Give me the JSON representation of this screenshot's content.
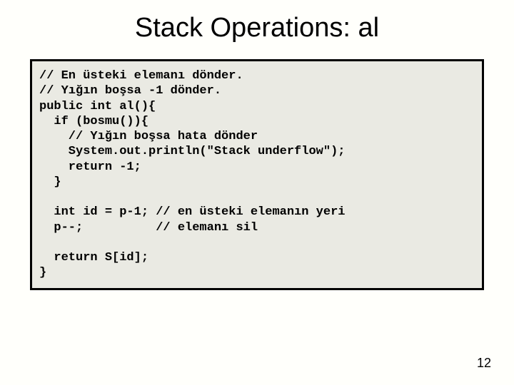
{
  "title": "Stack Operations: al",
  "code": {
    "l1": "// En üsteki elemanı dönder.",
    "l2": "// Yığın boşsa -1 dönder.",
    "l3": "public int al(){",
    "l4": "  if (bosmu()){",
    "l5": "    // Yığın boşsa hata dönder",
    "l6": "    System.out.println(\"Stack underflow\");",
    "l7": "    return -1;",
    "l8": "  }",
    "l9": "",
    "l10": "  int id = p-1; // en üsteki elemanın yeri",
    "l11": "  p--;          // elemanı sil",
    "l12": "",
    "l13": "  return S[id];",
    "l14": "}"
  },
  "page_number": "12"
}
